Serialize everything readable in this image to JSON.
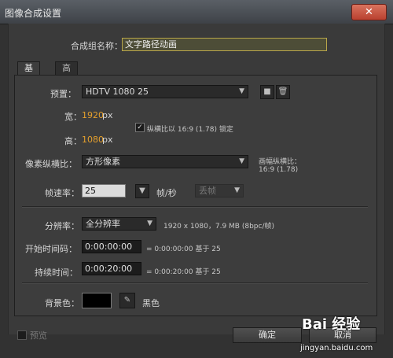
{
  "window": {
    "title": "图像合成设置",
    "close_glyph": "✕"
  },
  "comp_name": {
    "label": "合成组名称：",
    "value": "文字路径动画"
  },
  "tabs": [
    {
      "label": "基本"
    },
    {
      "label": "高级"
    }
  ],
  "preset": {
    "label": "预置：",
    "value": "HDTV 1080 25",
    "save_icon": "save-icon",
    "delete_icon": "trash-icon"
  },
  "width": {
    "label": "宽：",
    "value": "1920",
    "unit": "px"
  },
  "height": {
    "label": "高：",
    "value": "1080",
    "unit": "px"
  },
  "lock_aspect": {
    "label": "纵横比以 16:9 (1.78) 锁定",
    "checked": true
  },
  "pixel_aspect": {
    "label": "像素纵横比：",
    "value": "方形像素",
    "frame_aspect_label": "画幅纵横比：",
    "frame_aspect_value": "16:9 (1.78)"
  },
  "frame_rate": {
    "label": "帧速率：",
    "value": "25",
    "unit": "帧/秒",
    "drop_frame": "丢帧"
  },
  "resolution": {
    "label": "分辨率：",
    "value": "全分辨率",
    "info": "1920 x 1080，7.9 MB (8bpc/帧)"
  },
  "start_timecode": {
    "label": "开始时间码：",
    "value": "0:00:00:00",
    "info": "= 0:00:00:00  基于 25"
  },
  "duration": {
    "label": "持续时间：",
    "value": "0:00:20:00",
    "info": "= 0:00:20:00  基于 25"
  },
  "background": {
    "label": "背景色：",
    "color": "#000000",
    "name": "黑色",
    "eyedropper_icon": "eyedropper-icon"
  },
  "footer": {
    "preview_label": "预览",
    "ok_label": "确定",
    "cancel_label": "取消"
  },
  "watermark": {
    "brand": "Bai 经验",
    "url": "jingyan.baidu.com"
  },
  "colors": {
    "accent_orange": "#e5a02d",
    "close_red": "#c0493a"
  }
}
